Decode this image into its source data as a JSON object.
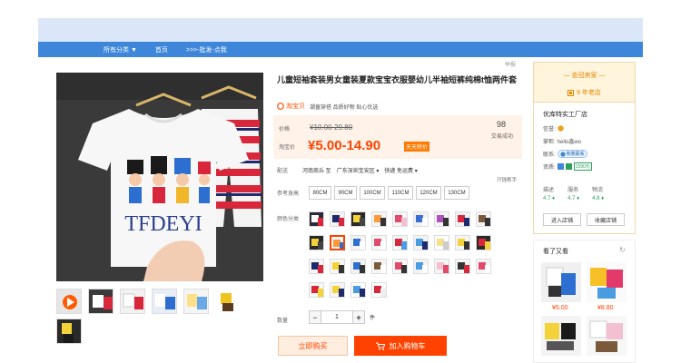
{
  "nav": {
    "items": [
      "所有分类 ▼",
      "首页",
      ">>>-批发-点我"
    ]
  },
  "report": "举报",
  "product": {
    "title": "儿童短袖套装男女童装夏款宝宝衣服婴幼儿半袖短裤纯棉t恤两件套",
    "tb_logo": "淘宝贝",
    "tb_slogan": "潮童穿搭 品质好物 贴心优选",
    "price_label": "价格",
    "orig_price": "¥10.00-29.80",
    "promo_label": "淘宝价",
    "promo_price": "¥5.00-14.90",
    "promo_tag": "天天特价",
    "sold_count": "98",
    "sold_label": "交易成功",
    "ship_label": "配送",
    "ship_from": "河南商丘 至",
    "ship_to": "广东深圳宝安区 ▾",
    "ship_fee": "快递 免运费 ▾",
    "fee_note": "只钱称手",
    "size_label": "参考身高",
    "sizes": [
      "80CM",
      "90CM",
      "100CM",
      "110CM",
      "120CM",
      "130CM"
    ],
    "color_label": "颜色分类",
    "qty_label": "数量",
    "qty_minus": "−",
    "qty_value": "1",
    "qty_plus": "+",
    "qty_unit": "件",
    "buy_label": "立即购买",
    "cart_label": "加入购物车",
    "main_image_text": "TFDEYI"
  },
  "shop": {
    "gold_title": "— 金冠卖家 —",
    "years": "9 年老店",
    "name": "优库特实工厂店",
    "credit_label": "信誉:",
    "owner_label": "掌柜:",
    "owner_value": "hello鑫wo",
    "contact_label": "联系:",
    "contact_value": "和我联系",
    "deposit_label": "资质:",
    "deposit_value": "1590元",
    "scores": [
      {
        "label": "描述",
        "value": "4.7 ♦"
      },
      {
        "label": "服务",
        "value": "4.7 ♦"
      },
      {
        "label": "物流",
        "value": "4.8 ♦"
      }
    ],
    "enter_btn": "进入店铺",
    "fav_btn": "收藏店铺"
  },
  "also": {
    "title": "看了又看",
    "refresh": "↻",
    "items": [
      {
        "price": "¥5.00"
      },
      {
        "price": "¥8.80"
      }
    ]
  },
  "colors": {
    "accent": "#ff4400",
    "nav": "#3d86d9",
    "band": "#dbe7f8",
    "gold": "#e38700",
    "score": "#2aa05b"
  }
}
